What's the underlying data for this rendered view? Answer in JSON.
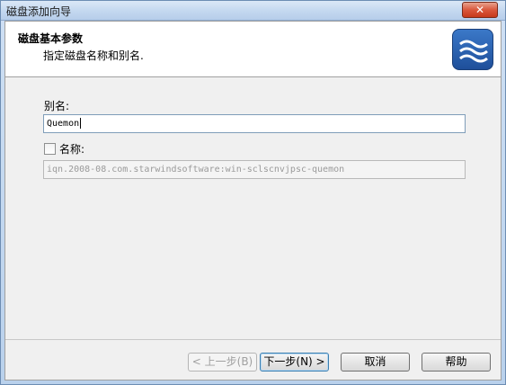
{
  "window": {
    "title": "磁盘添加向导",
    "close_label": "✕"
  },
  "header": {
    "title": "磁盘基本参数",
    "subtitle": "指定磁盘名称和别名."
  },
  "form": {
    "alias_label": "别名:",
    "alias_value": "Quemon",
    "name_label": "名称:",
    "name_checked": false,
    "name_value": "iqn.2008-08.com.starwindsoftware:win-sclscnvjpsc-quemon"
  },
  "buttons": {
    "back": "< 上一步(B)",
    "next": "下一步(N) >",
    "cancel": "取消",
    "help": "帮助"
  },
  "colors": {
    "logo_accent": "#1e4f9a",
    "close_button": "#c7391b"
  },
  "icons": {
    "logo": "starwind-waves-icon",
    "close": "close-icon"
  }
}
